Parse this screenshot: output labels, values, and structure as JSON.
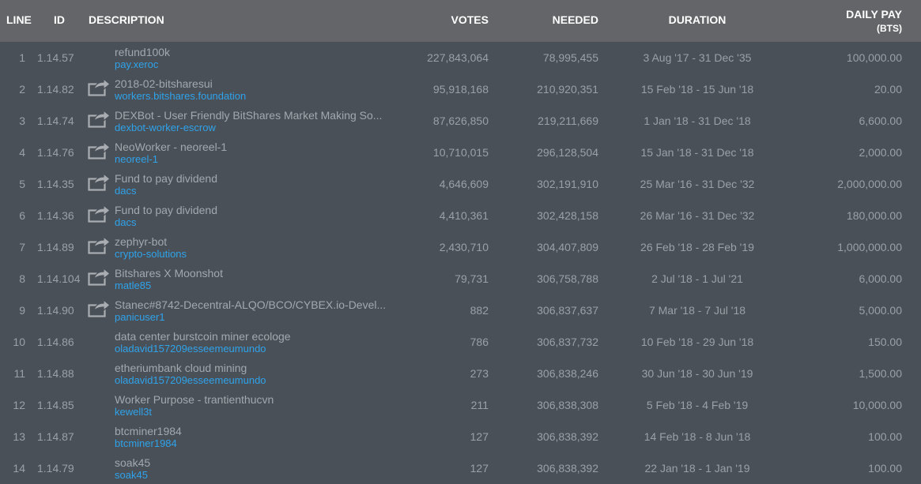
{
  "header": {
    "line": "LINE",
    "id": "ID",
    "description": "DESCRIPTION",
    "votes": "VOTES",
    "needed": "NEEDED",
    "duration": "DURATION",
    "daily_pay": "DAILY PAY",
    "daily_pay_unit": "(BTS)"
  },
  "rows": [
    {
      "line": "1",
      "id": "1.14.57",
      "icon": "none",
      "title": "refund100k",
      "account": "pay.xeroc",
      "votes": "227,843,064",
      "needed": "78,995,455",
      "duration": "3 Aug '17 - 31 Dec '35",
      "pay": "100,000.00"
    },
    {
      "line": "2",
      "id": "1.14.82",
      "icon": "share-icon",
      "title": "2018-02-bitsharesui",
      "account": "workers.bitshares.foundation",
      "votes": "95,918,168",
      "needed": "210,920,351",
      "duration": "15 Feb '18 - 15 Jun '18",
      "pay": "20.00"
    },
    {
      "line": "3",
      "id": "1.14.74",
      "icon": "share-icon",
      "title": "DEXBot - User Friendly BitShares Market Making So...",
      "account": "dexbot-worker-escrow",
      "votes": "87,626,850",
      "needed": "219,211,669",
      "duration": "1 Jan '18 - 31 Dec '18",
      "pay": "6,600.00"
    },
    {
      "line": "4",
      "id": "1.14.76",
      "icon": "share-icon",
      "title": "NeoWorker - neoreel-1",
      "account": "neoreel-1",
      "votes": "10,710,015",
      "needed": "296,128,504",
      "duration": "15 Jan '18 - 31 Dec '18",
      "pay": "2,000.00"
    },
    {
      "line": "5",
      "id": "1.14.35",
      "icon": "share-icon",
      "title": "Fund to pay dividend",
      "account": "dacs",
      "votes": "4,646,609",
      "needed": "302,191,910",
      "duration": "25 Mar '16 - 31 Dec '32",
      "pay": "2,000,000.00"
    },
    {
      "line": "6",
      "id": "1.14.36",
      "icon": "share-icon",
      "title": "Fund to pay dividend",
      "account": "dacs",
      "votes": "4,410,361",
      "needed": "302,428,158",
      "duration": "26 Mar '16 - 31 Dec '32",
      "pay": "180,000.00"
    },
    {
      "line": "7",
      "id": "1.14.89",
      "icon": "share-icon",
      "title": "zephyr-bot",
      "account": "crypto-solutions",
      "votes": "2,430,710",
      "needed": "304,407,809",
      "duration": "26 Feb '18 - 28 Feb '19",
      "pay": "1,000,000.00"
    },
    {
      "line": "8",
      "id": "1.14.104",
      "icon": "share-icon",
      "title": "Bitshares X Moonshot",
      "account": "matle85",
      "votes": "79,731",
      "needed": "306,758,788",
      "duration": "2 Jul '18 - 1 Jul '21",
      "pay": "6,000.00"
    },
    {
      "line": "9",
      "id": "1.14.90",
      "icon": "share-icon",
      "title": "Stanec#8742-Decentral-ALQO/BCO/CYBEX.io-Devel...",
      "account": "panicuser1",
      "votes": "882",
      "needed": "306,837,637",
      "duration": "7 Mar '18 - 7 Jul '18",
      "pay": "5,000.00"
    },
    {
      "line": "10",
      "id": "1.14.86",
      "icon": "none",
      "title": "data center burstcoin miner ecologe",
      "account": "oladavid157209esseemeumundo",
      "votes": "786",
      "needed": "306,837,732",
      "duration": "10 Feb '18 - 29 Jun '18",
      "pay": "150.00"
    },
    {
      "line": "11",
      "id": "1.14.88",
      "icon": "none",
      "title": "etheriumbank cloud mining",
      "account": "oladavid157209esseemeumundo",
      "votes": "273",
      "needed": "306,838,246",
      "duration": "30 Jun '18 - 30 Jun '19",
      "pay": "1,500.00"
    },
    {
      "line": "12",
      "id": "1.14.85",
      "icon": "none",
      "title": "Worker Purpose - trantienthucvn",
      "account": "kewell3t",
      "votes": "211",
      "needed": "306,838,308",
      "duration": "5 Feb '18 - 4 Feb '19",
      "pay": "10,000.00"
    },
    {
      "line": "13",
      "id": "1.14.87",
      "icon": "none",
      "title": "btcminer1984",
      "account": "btcminer1984",
      "votes": "127",
      "needed": "306,838,392",
      "duration": "14 Feb '18 - 8 Jun '18",
      "pay": "100.00"
    },
    {
      "line": "14",
      "id": "1.14.79",
      "icon": "none",
      "title": "soak45",
      "account": "soak45",
      "votes": "127",
      "needed": "306,838,392",
      "duration": "22 Jan '18 - 1 Jan '19",
      "pay": "100.00"
    }
  ]
}
